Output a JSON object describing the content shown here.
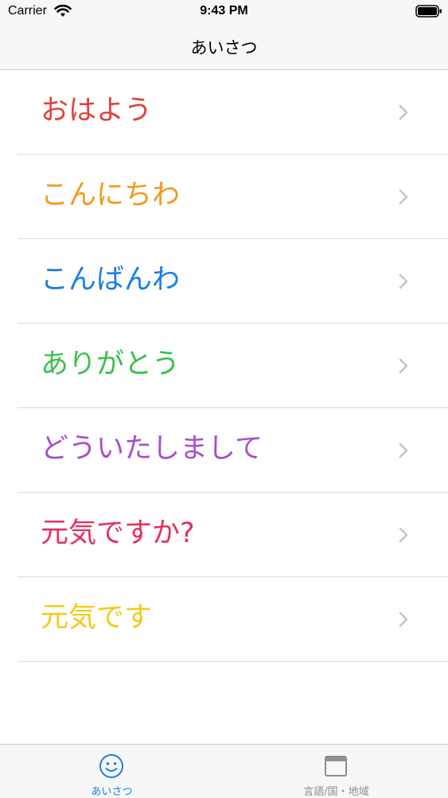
{
  "status_bar": {
    "carrier": "Carrier",
    "time": "9:43 PM",
    "wifi_icon": "wifi-icon",
    "battery_icon": "battery-icon"
  },
  "nav": {
    "title": "あいさつ"
  },
  "greetings": [
    {
      "label": "おはよう",
      "color": "#e0413a"
    },
    {
      "label": "こんにちわ",
      "color": "#f29a1a"
    },
    {
      "label": "こんばんわ",
      "color": "#1a7fe0"
    },
    {
      "label": "ありがとう",
      "color": "#38c24e"
    },
    {
      "label": "どういたしまして",
      "color": "#a64fd0"
    },
    {
      "label": "元気ですか?",
      "color": "#e5305f"
    },
    {
      "label": "元気です",
      "color": "#f2cb19"
    }
  ],
  "chevron_icon": "chevron-right-icon",
  "tab_bar": {
    "accent": "#1a7fe0",
    "inactive": "#8e8e93",
    "tabs": [
      {
        "label": "あいさつ",
        "icon": "smiley-icon",
        "selected": true
      },
      {
        "label": "言語/国・地域",
        "icon": "window-icon",
        "selected": false
      }
    ]
  }
}
